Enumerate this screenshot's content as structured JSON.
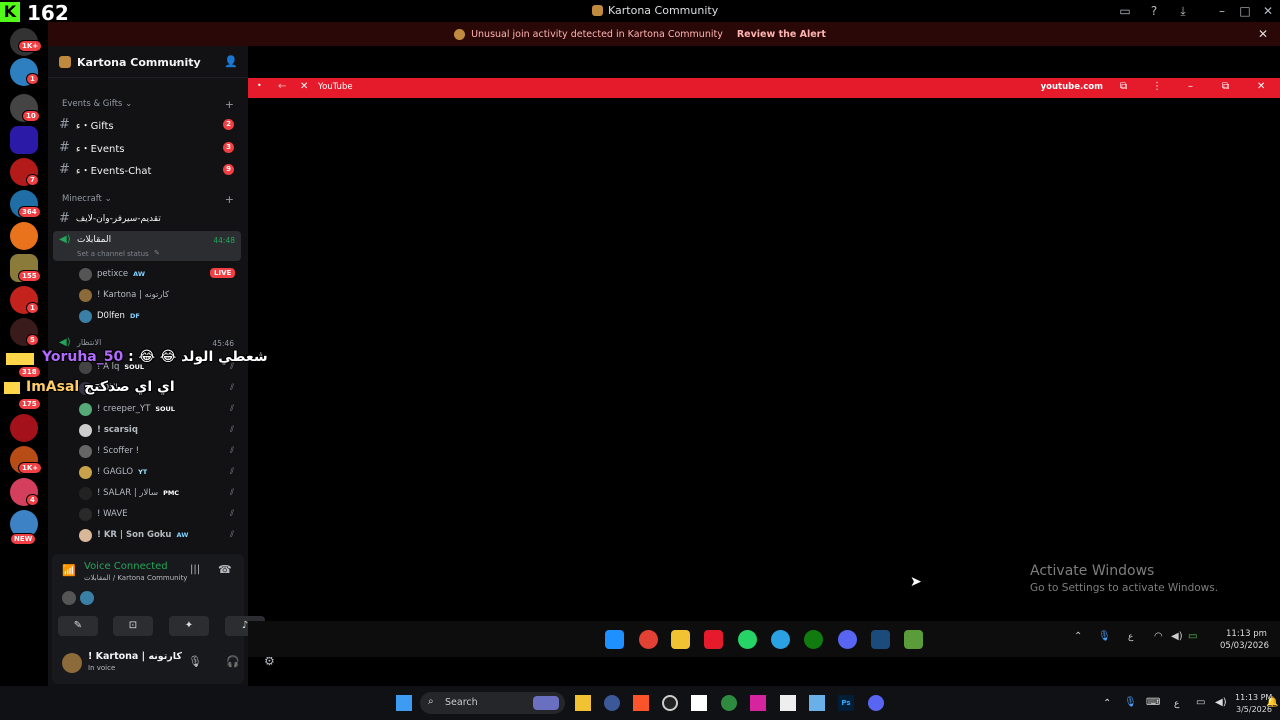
{
  "title_bar": {
    "kick_logo": "K",
    "stream_count": "162",
    "app_title": "Kartona Community"
  },
  "alert": {
    "message": "Unusual join activity detected in Kartona Community",
    "link": "Review the Alert"
  },
  "rail_badges": [
    "1K+",
    "1",
    "10",
    "7",
    "364",
    "155",
    "1",
    "5",
    "318",
    "175",
    "1K+",
    "4",
    "NEW"
  ],
  "server": {
    "name": "Kartona Community"
  },
  "categories": {
    "events": "Events & Gifts",
    "minecraft": "Minecraft"
  },
  "event_channels": [
    {
      "name": "ء・Gifts",
      "badge": "2"
    },
    {
      "name": "ء・Events",
      "badge": "3"
    },
    {
      "name": "ء・Events-Chat",
      "badge": "9"
    }
  ],
  "minecraft_channels": {
    "text_channel": "تقديم-سيرفر-وان-لايف",
    "voice1": {
      "name": "المقابلات",
      "time": "44:48",
      "status": "Set a channel status"
    },
    "voice1_users": [
      {
        "name": "petixce",
        "tag": "AW",
        "live": "LIVE"
      },
      {
        "name": "! Kartona | كارتونه",
        "tag": ""
      },
      {
        "name": "D0lfen",
        "tag": "DF"
      }
    ],
    "voice2": {
      "name": "الانتظار",
      "time": "45:46"
    },
    "voice2_users": [
      {
        "name": "! A lq",
        "tag": "SOUL"
      },
      {
        "name": "! creeper_YT",
        "tag": "SOUL"
      },
      {
        "name": "! scarsiq",
        "tag": ""
      },
      {
        "name": "! Scoffer !",
        "tag": ""
      },
      {
        "name": "! GAGLO",
        "tag": "YT"
      },
      {
        "name": "! SALAR | سالار",
        "tag": "PMC"
      },
      {
        "name": "! WAVE",
        "tag": ""
      },
      {
        "name": "! KR | Son Goku",
        "tag": "AW"
      }
    ]
  },
  "voice_panel": {
    "status": "Voice Connected",
    "location": "المقابلات / Kartona Community"
  },
  "user_panel": {
    "name": "! Kartona | كارتونه",
    "status": "In voice"
  },
  "browser": {
    "title": "YouTube",
    "url": "youtube.com"
  },
  "watermark": {
    "line1": "Activate Windows",
    "line2": "Go to Settings to activate Windows."
  },
  "inner_taskbar": {
    "time": "11:13 pm",
    "date": "05/03/2026",
    "lang": "ع"
  },
  "outer_taskbar": {
    "search_placeholder": "Search",
    "time": "11:13 PM",
    "date": "3/5/2026",
    "lang": "ع"
  },
  "chat_overlay": [
    {
      "user": "Yoruha_50",
      "text": ": 😂 😂 شعطي الولد"
    },
    {
      "user": "ImAsal",
      "text": "اي اي صدكتج"
    }
  ],
  "colors": {
    "kick_green": "#53fc18",
    "youtube_red": "#e51b2b",
    "discord_red": "#f23f43",
    "voice_green": "#23a55a"
  }
}
